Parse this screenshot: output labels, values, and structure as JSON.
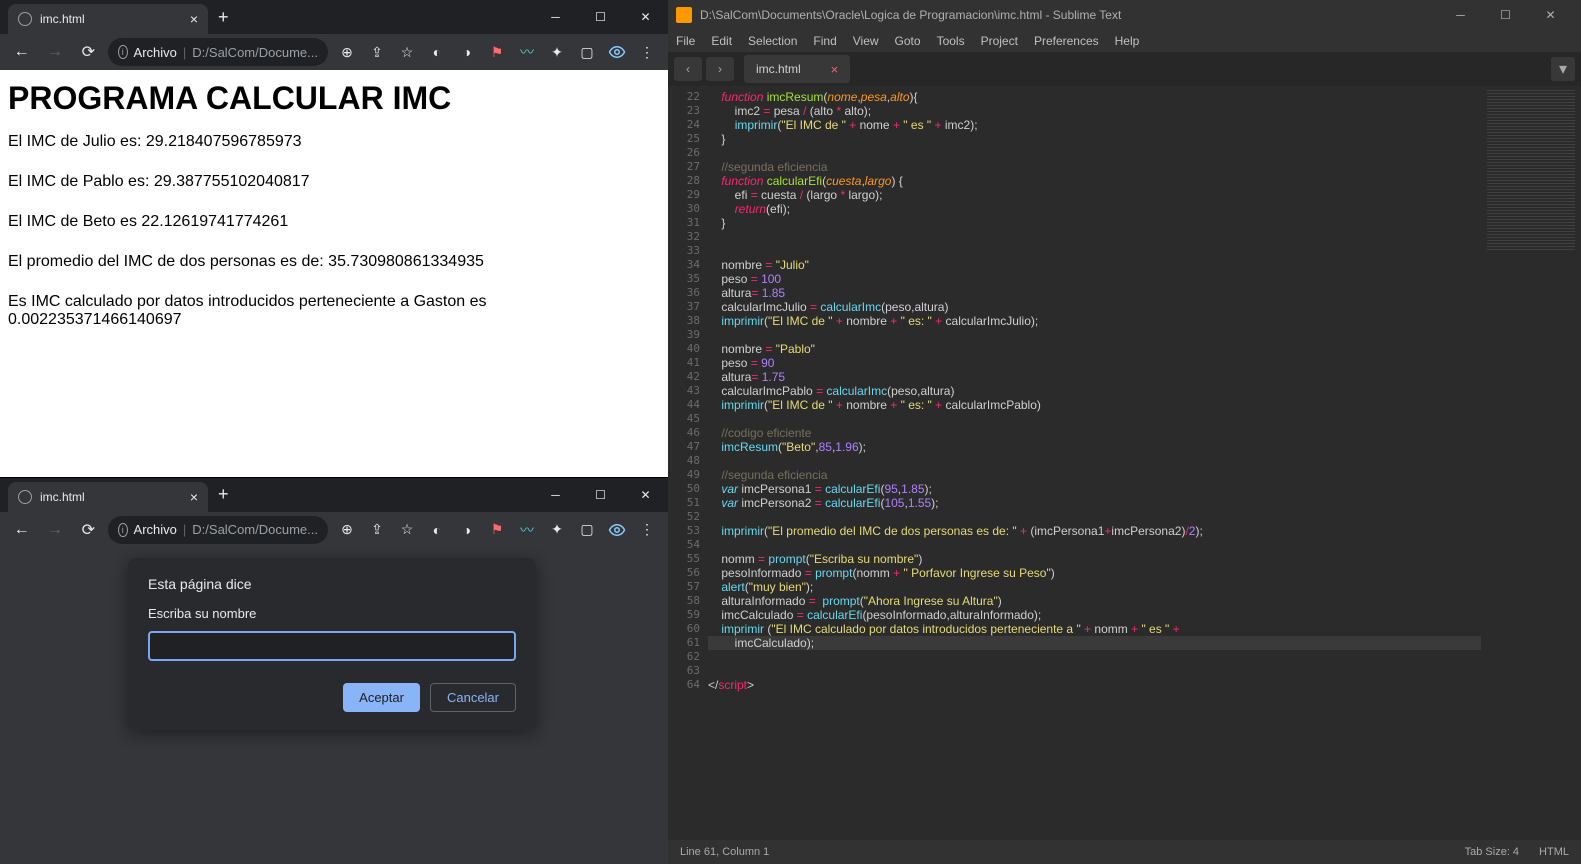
{
  "chrome1": {
    "tab_title": "imc.html",
    "url_scheme": "Archivo",
    "url_path": "D:/SalCom/Docume...",
    "nav_symbols": {
      "back": "←",
      "fwd": "→",
      "reload": "⟳"
    },
    "ext_zoom": "⊕",
    "ext_share": "⇪",
    "ext_star": "☆",
    "ext_puzzle": "✦",
    "ext_square": "▢",
    "ext_menu": "⋮"
  },
  "page": {
    "h1": "PROGRAMA CALCULAR IMC",
    "p1": "El IMC de Julio es: 29.218407596785973",
    "p2": "El IMC de Pablo es: 29.387755102040817",
    "p3": "El IMC de Beto es 22.12619741774261",
    "p4": "El promedio del IMC de dos personas es de: 35.730980861334935",
    "p5": "Es IMC calculado por datos introducidos perteneciente a Gaston es 0.002235371466140697"
  },
  "dialog": {
    "header": "Esta página dice",
    "label": "Escriba su nombre",
    "input_value": "",
    "ok": "Aceptar",
    "cancel": "Cancelar"
  },
  "sublime": {
    "titlebar": "D:\\SalCom\\Documents\\Oracle\\Logica de Programacion\\imc.html - Sublime Text",
    "menu": [
      "File",
      "Edit",
      "Selection",
      "Find",
      "View",
      "Goto",
      "Tools",
      "Project",
      "Preferences",
      "Help"
    ],
    "tab": "imc.html",
    "status_left": "Line 61, Column 1",
    "status_tab": "Tab Size: 4",
    "status_lang": "HTML"
  },
  "code": {
    "line_start": 22,
    "lines": [
      [
        [
          "kw",
          "function"
        ],
        [
          "pl",
          " "
        ],
        [
          "fn2",
          "imcResum"
        ],
        [
          "pl",
          "("
        ],
        [
          "prm",
          "nome"
        ],
        [
          "pl",
          ","
        ],
        [
          "prm",
          "pesa"
        ],
        [
          "pl",
          ","
        ],
        [
          "prm",
          "alto"
        ],
        [
          "pl",
          ")"
        ],
        [
          "pl",
          "{"
        ]
      ],
      [
        [
          "pl",
          "    imc2 "
        ],
        [
          "op",
          "="
        ],
        [
          "pl",
          " pesa "
        ],
        [
          "op",
          "/"
        ],
        [
          "pl",
          " (alto "
        ],
        [
          "op",
          "*"
        ],
        [
          "pl",
          " alto);"
        ]
      ],
      [
        [
          "pl",
          "    "
        ],
        [
          "fn",
          "imprimir"
        ],
        [
          "pl",
          "("
        ],
        [
          "str",
          "\"El IMC de \""
        ],
        [
          "pl",
          " "
        ],
        [
          "op",
          "+"
        ],
        [
          "pl",
          " nome "
        ],
        [
          "op",
          "+"
        ],
        [
          "pl",
          " "
        ],
        [
          "str",
          "\" es \""
        ],
        [
          "pl",
          " "
        ],
        [
          "op",
          "+"
        ],
        [
          "pl",
          " imc2);"
        ]
      ],
      [
        [
          "pl",
          "}"
        ]
      ],
      [],
      [
        [
          "cmt",
          "//segunda eficiencia"
        ]
      ],
      [
        [
          "kw",
          "function"
        ],
        [
          "pl",
          " "
        ],
        [
          "fn2",
          "calcularEfi"
        ],
        [
          "pl",
          "("
        ],
        [
          "prm",
          "cuesta"
        ],
        [
          "pl",
          ","
        ],
        [
          "prm",
          "largo"
        ],
        [
          "pl",
          ") {"
        ]
      ],
      [
        [
          "pl",
          "    efi "
        ],
        [
          "op",
          "="
        ],
        [
          "pl",
          " cuesta "
        ],
        [
          "op",
          "/"
        ],
        [
          "pl",
          " (largo "
        ],
        [
          "op",
          "*"
        ],
        [
          "pl",
          " largo);"
        ]
      ],
      [
        [
          "pl",
          "    "
        ],
        [
          "kw",
          "return"
        ],
        [
          "pl",
          "(efi);"
        ]
      ],
      [
        [
          "pl",
          "}"
        ]
      ],
      [],
      [],
      [
        [
          "pl",
          "nombre "
        ],
        [
          "op",
          "="
        ],
        [
          "pl",
          " "
        ],
        [
          "str",
          "\"Julio\""
        ]
      ],
      [
        [
          "pl",
          "peso "
        ],
        [
          "op",
          "="
        ],
        [
          "pl",
          " "
        ],
        [
          "num",
          "100"
        ]
      ],
      [
        [
          "pl",
          "altura"
        ],
        [
          "op",
          "="
        ],
        [
          "pl",
          " "
        ],
        [
          "num",
          "1.85"
        ]
      ],
      [
        [
          "pl",
          "calcularImcJulio "
        ],
        [
          "op",
          "="
        ],
        [
          "pl",
          " "
        ],
        [
          "fn",
          "calcularImc"
        ],
        [
          "pl",
          "(peso,altura)"
        ]
      ],
      [
        [
          "fn",
          "imprimir"
        ],
        [
          "pl",
          "("
        ],
        [
          "str",
          "\"El IMC de \""
        ],
        [
          "pl",
          " "
        ],
        [
          "op",
          "+"
        ],
        [
          "pl",
          " nombre "
        ],
        [
          "op",
          "+"
        ],
        [
          "pl",
          " "
        ],
        [
          "str",
          "\" es: \""
        ],
        [
          "pl",
          " "
        ],
        [
          "op",
          "+"
        ],
        [
          "pl",
          " calcularImcJulio);"
        ]
      ],
      [],
      [
        [
          "pl",
          "nombre "
        ],
        [
          "op",
          "="
        ],
        [
          "pl",
          " "
        ],
        [
          "str",
          "\"Pablo\""
        ]
      ],
      [
        [
          "pl",
          "peso "
        ],
        [
          "op",
          "="
        ],
        [
          "pl",
          " "
        ],
        [
          "num",
          "90"
        ]
      ],
      [
        [
          "pl",
          "altura"
        ],
        [
          "op",
          "="
        ],
        [
          "pl",
          " "
        ],
        [
          "num",
          "1.75"
        ]
      ],
      [
        [
          "pl",
          "calcularImcPablo "
        ],
        [
          "op",
          "="
        ],
        [
          "pl",
          " "
        ],
        [
          "fn",
          "calcularImc"
        ],
        [
          "pl",
          "(peso,altura)"
        ]
      ],
      [
        [
          "fn",
          "imprimir"
        ],
        [
          "pl",
          "("
        ],
        [
          "str",
          "\"El IMC de \""
        ],
        [
          "pl",
          " "
        ],
        [
          "op",
          "+"
        ],
        [
          "pl",
          " nombre "
        ],
        [
          "op",
          "+"
        ],
        [
          "pl",
          " "
        ],
        [
          "str",
          "\" es: \""
        ],
        [
          "pl",
          " "
        ],
        [
          "op",
          "+"
        ],
        [
          "pl",
          " calcularImcPablo)"
        ]
      ],
      [],
      [
        [
          "cmt",
          "//codigo eficiente"
        ]
      ],
      [
        [
          "fn",
          "imcResum"
        ],
        [
          "pl",
          "("
        ],
        [
          "str",
          "\"Beto\""
        ],
        [
          "pl",
          ","
        ],
        [
          "num",
          "85"
        ],
        [
          "pl",
          ","
        ],
        [
          "num",
          "1.96"
        ],
        [
          "pl",
          ");"
        ]
      ],
      [],
      [
        [
          "cmt",
          "//segunda eficiencia"
        ]
      ],
      [
        [
          "var",
          "var"
        ],
        [
          "pl",
          " imcPersona1 "
        ],
        [
          "op",
          "="
        ],
        [
          "pl",
          " "
        ],
        [
          "fn",
          "calcularEfi"
        ],
        [
          "pl",
          "("
        ],
        [
          "num",
          "95"
        ],
        [
          "pl",
          ","
        ],
        [
          "num",
          "1.85"
        ],
        [
          "pl",
          ");"
        ]
      ],
      [
        [
          "var",
          "var"
        ],
        [
          "pl",
          " imcPersona2 "
        ],
        [
          "op",
          "="
        ],
        [
          "pl",
          " "
        ],
        [
          "fn",
          "calcularEfi"
        ],
        [
          "pl",
          "("
        ],
        [
          "num",
          "105"
        ],
        [
          "pl",
          ","
        ],
        [
          "num",
          "1.55"
        ],
        [
          "pl",
          ");"
        ]
      ],
      [],
      [
        [
          "fn",
          "imprimir"
        ],
        [
          "pl",
          "("
        ],
        [
          "str",
          "\"El promedio del IMC de dos personas es de: \""
        ],
        [
          "pl",
          " "
        ],
        [
          "op",
          "+"
        ],
        [
          "pl",
          " (imcPersona1"
        ],
        [
          "op",
          "+"
        ],
        [
          "pl",
          "imcPersona2)"
        ],
        [
          "op",
          "/"
        ],
        [
          "num",
          "2"
        ],
        [
          "pl",
          ");"
        ]
      ],
      [],
      [
        [
          "pl",
          "nomm "
        ],
        [
          "op",
          "="
        ],
        [
          "pl",
          " "
        ],
        [
          "fn",
          "prompt"
        ],
        [
          "pl",
          "("
        ],
        [
          "str",
          "\"Escriba su nombre\""
        ],
        [
          "pl",
          ")"
        ]
      ],
      [
        [
          "pl",
          "pesoInformado "
        ],
        [
          "op",
          "="
        ],
        [
          "pl",
          " "
        ],
        [
          "fn",
          "prompt"
        ],
        [
          "pl",
          "(nomm "
        ],
        [
          "op",
          "+"
        ],
        [
          "pl",
          " "
        ],
        [
          "str",
          "\" Porfavor Ingrese su Peso\""
        ],
        [
          "pl",
          ")"
        ]
      ],
      [
        [
          "fn",
          "alert"
        ],
        [
          "pl",
          "("
        ],
        [
          "str",
          "\"muy bien\""
        ],
        [
          "pl",
          ");"
        ]
      ],
      [
        [
          "pl",
          "alturaInformado "
        ],
        [
          "op",
          "="
        ],
        [
          "pl",
          "  "
        ],
        [
          "fn",
          "prompt"
        ],
        [
          "pl",
          "("
        ],
        [
          "str",
          "\"Ahora Ingrese su Altura\""
        ],
        [
          "pl",
          ")"
        ]
      ],
      [
        [
          "pl",
          "imcCalculado "
        ],
        [
          "op",
          "="
        ],
        [
          "pl",
          " "
        ],
        [
          "fn",
          "calcularEfi"
        ],
        [
          "pl",
          "(pesoInformado,alturaInformado);"
        ]
      ],
      [
        [
          "fn",
          "imprimir"
        ],
        [
          "pl",
          " ("
        ],
        [
          "str",
          "\"El IMC calculado por datos introducidos perteneciente a \""
        ],
        [
          "pl",
          " "
        ],
        [
          "op",
          "+"
        ],
        [
          "pl",
          " nomm "
        ],
        [
          "op",
          "+"
        ],
        [
          "pl",
          " "
        ],
        [
          "str",
          "\" es \""
        ],
        [
          "pl",
          " "
        ],
        [
          "op",
          "+"
        ]
      ],
      [
        [
          "pl",
          "    imcCalculado);"
        ]
      ],
      [],
      [],
      [
        [
          "pl",
          "</"
        ],
        [
          "op",
          "script"
        ],
        [
          "pl",
          ">"
        ]
      ]
    ],
    "highlight_line": 61
  }
}
